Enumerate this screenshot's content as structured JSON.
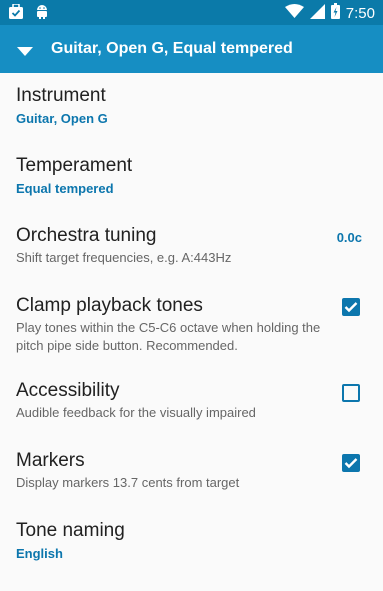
{
  "status_bar": {
    "time": "7:50",
    "icons": [
      "briefcase-check-icon",
      "android-icon",
      "wifi-icon",
      "signal-icon",
      "battery-charging-icon"
    ]
  },
  "app_bar": {
    "title": "Guitar, Open G, Equal tempered",
    "menu_icon": "dropdown-triangle-icon"
  },
  "preferences": {
    "instrument": {
      "title": "Instrument",
      "value": "Guitar, Open G"
    },
    "temperament": {
      "title": "Temperament",
      "value": "Equal tempered"
    },
    "orchestra_tuning": {
      "title": "Orchestra tuning",
      "summary": "Shift target frequencies, e.g. A:443Hz",
      "value": "0.0c"
    },
    "clamp_playback_tones": {
      "title": "Clamp playback tones",
      "summary": "Play tones within the C5-C6 octave when holding the pitch pipe side button. Recommended.",
      "checked": true
    },
    "accessibility": {
      "title": "Accessibility",
      "summary": "Audible feedback for the visually impaired",
      "checked": false
    },
    "markers": {
      "title": "Markers",
      "summary": "Display markers 13.7 cents from target",
      "checked": true
    },
    "tone_naming": {
      "title": "Tone naming",
      "value": "English"
    }
  },
  "colors": {
    "status_bar": "#0b7aa9",
    "app_bar": "#168ec3",
    "accent": "#0c76ad",
    "title_text": "#212121",
    "summary_text": "#666666",
    "background": "#fafafa"
  }
}
